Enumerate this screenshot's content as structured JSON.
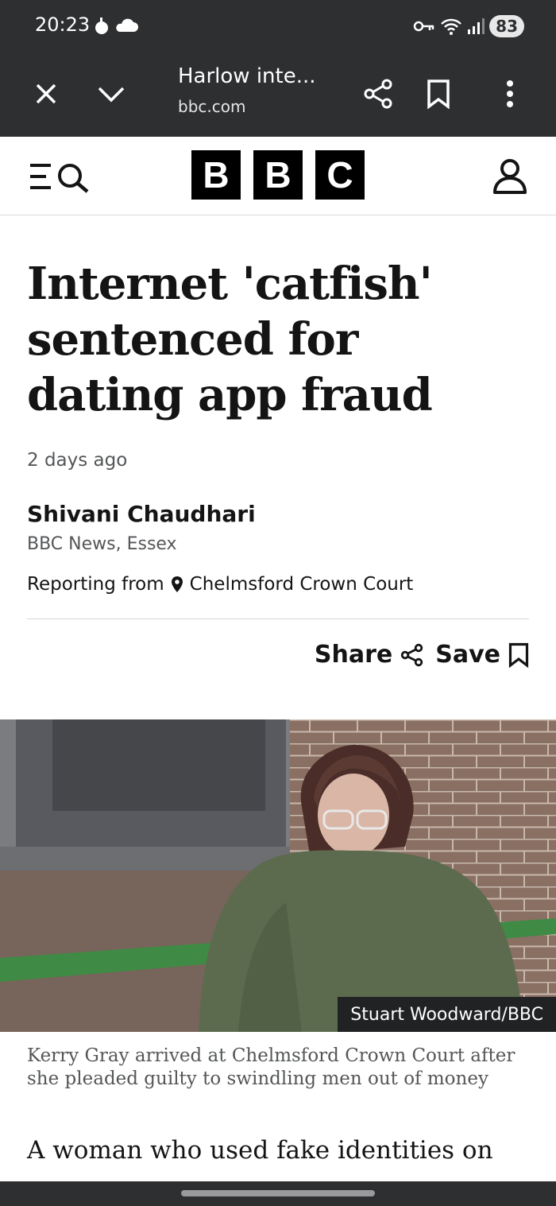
{
  "status_bar": {
    "time": "20:23",
    "battery": "83",
    "icons_left": [
      "weather-icon",
      "cloud-icon"
    ],
    "icons_right": [
      "vpn-key-icon",
      "wifi-icon",
      "signal-icon"
    ]
  },
  "browser_toolbar": {
    "title": "Harlow inte...",
    "url": "bbc.com",
    "icons": [
      "close-icon",
      "chevron-down-icon",
      "share-icon",
      "bookmark-icon",
      "more-vert-icon"
    ]
  },
  "site_header": {
    "logo_letters": [
      "B",
      "B",
      "C"
    ],
    "icons": [
      "menu-search-icon",
      "account-icon"
    ]
  },
  "article": {
    "headline": "Internet 'catfish' sentenced for dating app fraud",
    "date": "2 days ago",
    "author": "Shivani Chaudhari",
    "outlet": "BBC News, Essex",
    "reporting_prefix": "Reporting from",
    "reporting_location": "Chelmsford Crown Court",
    "share_label": "Share",
    "save_label": "Save",
    "image_credit": "Stuart Woodward/BBC",
    "image_caption": "Kerry Gray arrived at Chelmsford Crown Court after she pleaded guilty to swindling men out of money",
    "body_start": "A woman who used fake identities on"
  },
  "colors": {
    "chrome_bg": "#2e2f31",
    "text": "#141414",
    "muted_text": "#545658",
    "logo_bg": "#000000"
  }
}
